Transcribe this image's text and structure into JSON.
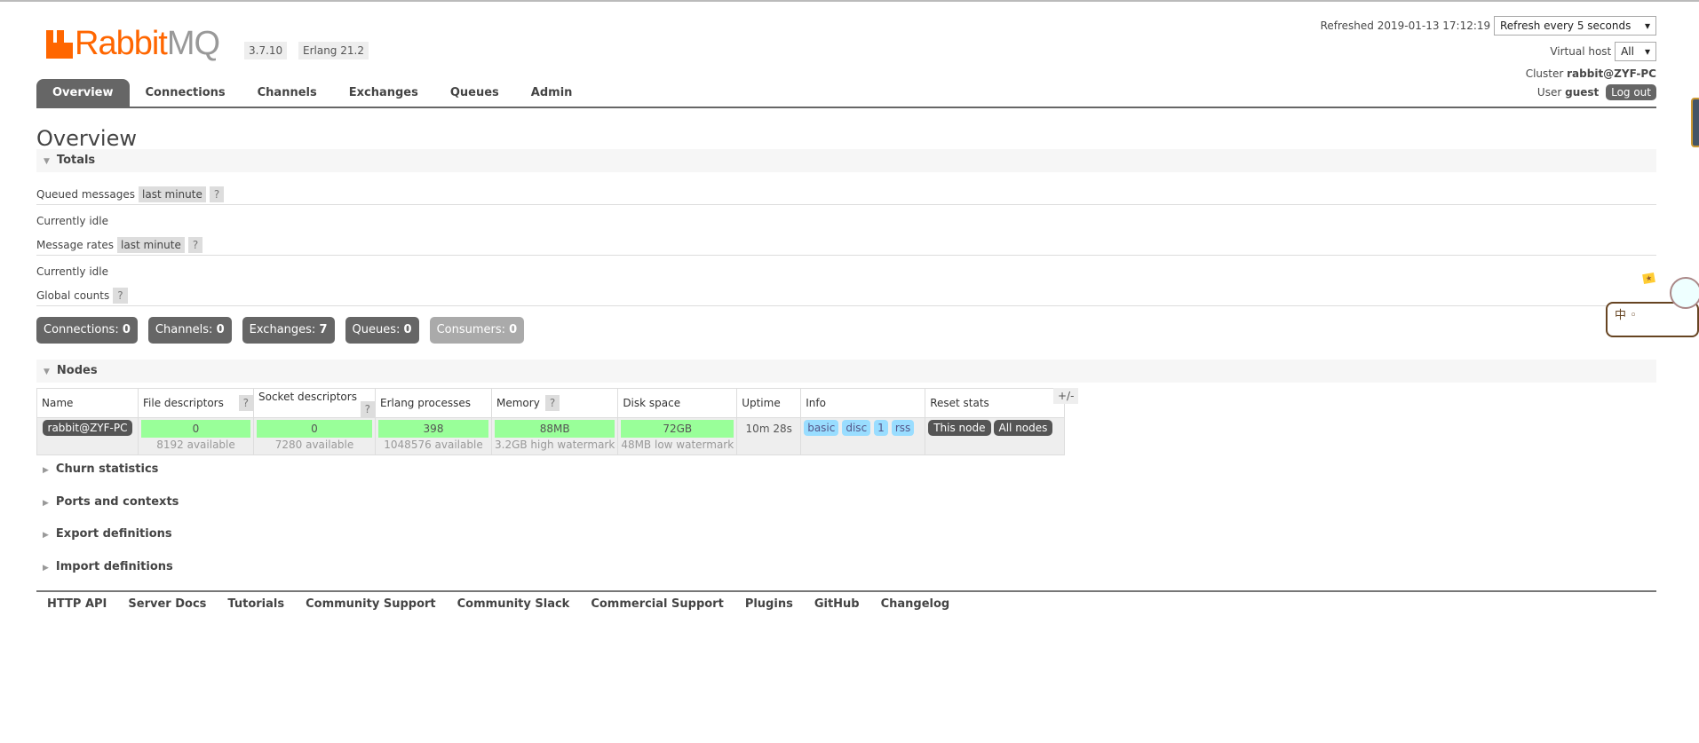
{
  "brand": {
    "name_part1": "Rabbit",
    "name_part2": "MQ",
    "version": "3.7.10",
    "erlang": "Erlang 21.2",
    "color": "#ff6600"
  },
  "tabs": [
    "Overview",
    "Connections",
    "Channels",
    "Exchanges",
    "Queues",
    "Admin"
  ],
  "active_tab": "Overview",
  "header": {
    "refreshed_label": "Refreshed 2019-01-13 17:12:19",
    "refresh_select": "Refresh every 5 seconds",
    "vhost_label": "Virtual host",
    "vhost_value": "All",
    "cluster_label": "Cluster",
    "cluster_value": "rabbit@ZYF-PC",
    "user_label": "User",
    "user_value": "guest",
    "logout": "Log out"
  },
  "page_title": "Overview",
  "totals": {
    "title": "Totals",
    "queued_label": "Queued messages",
    "queued_range": "last minute",
    "help": "?",
    "queued_status": "Currently idle",
    "rates_label": "Message rates",
    "rates_range": "last minute",
    "rates_status": "Currently idle",
    "global_label": "Global counts",
    "counts": [
      {
        "label": "Connections:",
        "value": "0"
      },
      {
        "label": "Channels:",
        "value": "0"
      },
      {
        "label": "Exchanges:",
        "value": "7"
      },
      {
        "label": "Queues:",
        "value": "0"
      },
      {
        "label": "Consumers:",
        "value": "0"
      }
    ]
  },
  "nodes": {
    "title": "Nodes",
    "columns": [
      "Name",
      "File descriptors",
      "Socket descriptors",
      "Erlang processes",
      "Memory",
      "Disk space",
      "Uptime",
      "Info",
      "Reset stats"
    ],
    "row": {
      "name": "rabbit@ZYF-PC",
      "fd": "0",
      "fd_sub": "8192 available",
      "sd": "0",
      "sd_sub": "7280 available",
      "ep": "398",
      "ep_sub": "1048576 available",
      "mem": "88MB",
      "mem_sub": "3.2GB high watermark",
      "disk": "72GB",
      "disk_sub": "48MB low watermark",
      "uptime": "10m 28s",
      "info": [
        "basic",
        "disc",
        "1",
        "rss"
      ],
      "reset_this": "This node",
      "reset_all": "All nodes"
    },
    "toggle": "+/-"
  },
  "sections": [
    "Churn statistics",
    "Ports and contexts",
    "Export definitions",
    "Import definitions"
  ],
  "footer": [
    "HTTP API",
    "Server Docs",
    "Tutorials",
    "Community Support",
    "Community Slack",
    "Commercial Support",
    "Plugins",
    "GitHub",
    "Changelog"
  ]
}
